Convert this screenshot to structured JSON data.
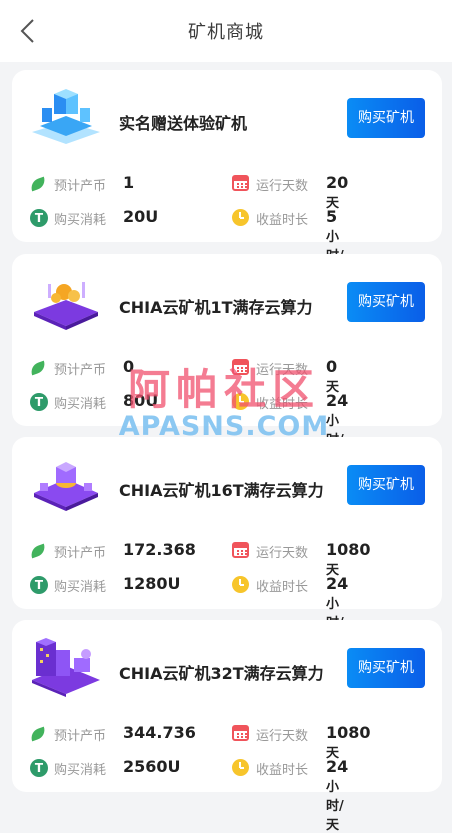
{
  "header": {
    "title": "矿机商城",
    "back_icon": "chevron-left-icon"
  },
  "labels": {
    "output": "预计产币",
    "days": "运行天数",
    "cost": "购买消耗",
    "hours": "收益时长",
    "buy": "购买矿机"
  },
  "icons": {
    "output": "leaf-icon",
    "cost": "t-coin-icon",
    "days": "calendar-icon",
    "hours": "clock-icon"
  },
  "colors": {
    "buy_button": "#0a7af0",
    "leaf": "#42b35c",
    "coin": "#2e9b6a",
    "calendar": "#f0545b",
    "clock": "#f7c52b"
  },
  "products": [
    {
      "name": "实名赠送体验矿机",
      "output": "1",
      "days": "20",
      "days_unit": "天",
      "cost": "20U",
      "hours": "5",
      "hours_unit": "小时/天"
    },
    {
      "name": "CHIA云矿机1T满存云算力",
      "output": "0",
      "days": "0",
      "days_unit": "天",
      "cost": "80U",
      "hours": "24",
      "hours_unit": "小时/天"
    },
    {
      "name": "CHIA云矿机16T满存云算力",
      "output": "172.368",
      "days": "1080",
      "days_unit": "天",
      "cost": "1280U",
      "hours": "24",
      "hours_unit": "小时/天"
    },
    {
      "name": "CHIA云矿机32T满存云算力",
      "output": "344.736",
      "days": "1080",
      "days_unit": "天",
      "cost": "2560U",
      "hours": "24",
      "hours_unit": "小时/天"
    }
  ],
  "watermark": {
    "cn": "阿帕社区",
    "en": "APASNS.COM"
  }
}
